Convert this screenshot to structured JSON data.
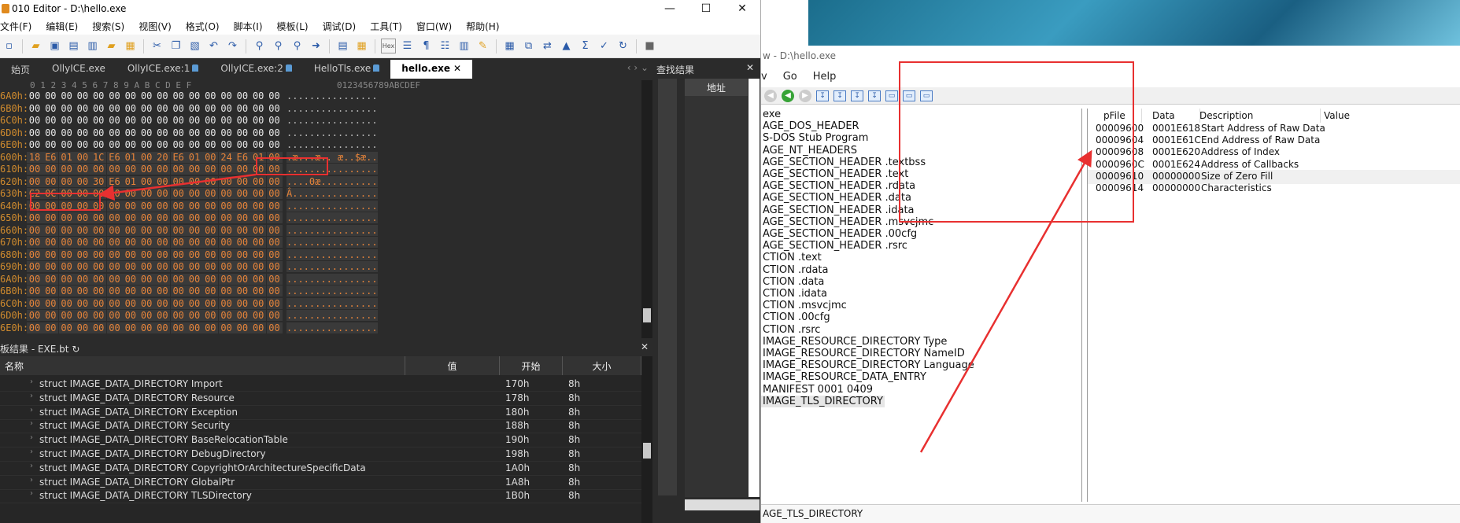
{
  "editor": {
    "title": "010 Editor - D:\\hello.exe",
    "win_min": "—",
    "win_max": "☐",
    "win_close": "✕",
    "menu": [
      "文件(F)",
      "编辑(E)",
      "搜索(S)",
      "视图(V)",
      "格式(O)",
      "脚本(I)",
      "模板(L)",
      "调试(D)",
      "工具(T)",
      "窗口(W)",
      "帮助(H)"
    ],
    "tabs": [
      {
        "label": "始页",
        "locked": false,
        "active": false
      },
      {
        "label": "OllyICE.exe",
        "locked": false,
        "active": false
      },
      {
        "label": "OllyICE.exe:1",
        "locked": true,
        "active": false
      },
      {
        "label": "OllyICE.exe:2",
        "locked": true,
        "active": false
      },
      {
        "label": "HelloTls.exe",
        "locked": true,
        "active": false
      },
      {
        "label": "hello.exe",
        "locked": false,
        "active": true
      }
    ],
    "tab_close": "✕",
    "tab_nav": "‹ › ⌄",
    "hex_header": "0  1  2  3  4  5  6  7  8  9  A  B  C  D  E  F",
    "ascii_header": "0123456789ABCDEF",
    "hex_rows": [
      {
        "off": "6A0h:",
        "bytes": [
          "00",
          "00",
          "00",
          "00",
          "00",
          "00",
          "00",
          "00",
          "00",
          "00",
          "00",
          "00",
          "00",
          "00",
          "00",
          "00"
        ],
        "ascii": "................",
        "changed": false
      },
      {
        "off": "6B0h:",
        "bytes": [
          "00",
          "00",
          "00",
          "00",
          "00",
          "00",
          "00",
          "00",
          "00",
          "00",
          "00",
          "00",
          "00",
          "00",
          "00",
          "00"
        ],
        "ascii": "................",
        "changed": false
      },
      {
        "off": "6C0h:",
        "bytes": [
          "00",
          "00",
          "00",
          "00",
          "00",
          "00",
          "00",
          "00",
          "00",
          "00",
          "00",
          "00",
          "00",
          "00",
          "00",
          "00"
        ],
        "ascii": "................",
        "changed": false
      },
      {
        "off": "6D0h:",
        "bytes": [
          "00",
          "00",
          "00",
          "00",
          "00",
          "00",
          "00",
          "00",
          "00",
          "00",
          "00",
          "00",
          "00",
          "00",
          "00",
          "00"
        ],
        "ascii": "................",
        "changed": false
      },
      {
        "off": "6E0h:",
        "bytes": [
          "00",
          "00",
          "00",
          "00",
          "00",
          "00",
          "00",
          "00",
          "00",
          "00",
          "00",
          "00",
          "00",
          "00",
          "00",
          "00"
        ],
        "ascii": "................",
        "changed": false
      },
      {
        "off": "600h:",
        "bytes": [
          "18",
          "E6",
          "01",
          "00",
          "1C",
          "E6",
          "01",
          "00",
          "20",
          "E6",
          "01",
          "00",
          "24",
          "E6",
          "01",
          "00"
        ],
        "ascii": ".æ...æ.. æ..$æ..",
        "changed": true
      },
      {
        "off": "610h:",
        "bytes": [
          "00",
          "00",
          "00",
          "00",
          "00",
          "00",
          "00",
          "00",
          "00",
          "00",
          "00",
          "00",
          "00",
          "00",
          "00",
          "00"
        ],
        "ascii": "................",
        "changed": true
      },
      {
        "off": "620h:",
        "bytes": [
          "00",
          "00",
          "00",
          "00",
          "30",
          "E6",
          "01",
          "00",
          "00",
          "00",
          "00",
          "00",
          "00",
          "00",
          "00",
          "00"
        ],
        "ascii": "....0æ..........",
        "changed": true
      },
      {
        "off": "630h:",
        "bytes": [
          "C2",
          "0C",
          "00",
          "00",
          "00",
          "00",
          "00",
          "00",
          "00",
          "00",
          "00",
          "00",
          "00",
          "00",
          "00",
          "00"
        ],
        "ascii": "Â...............",
        "changed": true
      },
      {
        "off": "640h:",
        "bytes": [
          "00",
          "00",
          "00",
          "00",
          "00",
          "00",
          "00",
          "00",
          "00",
          "00",
          "00",
          "00",
          "00",
          "00",
          "00",
          "00"
        ],
        "ascii": "................",
        "changed": true
      },
      {
        "off": "650h:",
        "bytes": [
          "00",
          "00",
          "00",
          "00",
          "00",
          "00",
          "00",
          "00",
          "00",
          "00",
          "00",
          "00",
          "00",
          "00",
          "00",
          "00"
        ],
        "ascii": "................",
        "changed": true
      },
      {
        "off": "660h:",
        "bytes": [
          "00",
          "00",
          "00",
          "00",
          "00",
          "00",
          "00",
          "00",
          "00",
          "00",
          "00",
          "00",
          "00",
          "00",
          "00",
          "00"
        ],
        "ascii": "................",
        "changed": true
      },
      {
        "off": "670h:",
        "bytes": [
          "00",
          "00",
          "00",
          "00",
          "00",
          "00",
          "00",
          "00",
          "00",
          "00",
          "00",
          "00",
          "00",
          "00",
          "00",
          "00"
        ],
        "ascii": "................",
        "changed": true
      },
      {
        "off": "680h:",
        "bytes": [
          "00",
          "00",
          "00",
          "00",
          "00",
          "00",
          "00",
          "00",
          "00",
          "00",
          "00",
          "00",
          "00",
          "00",
          "00",
          "00"
        ],
        "ascii": "................",
        "changed": true
      },
      {
        "off": "690h:",
        "bytes": [
          "00",
          "00",
          "00",
          "00",
          "00",
          "00",
          "00",
          "00",
          "00",
          "00",
          "00",
          "00",
          "00",
          "00",
          "00",
          "00"
        ],
        "ascii": "................",
        "changed": true
      },
      {
        "off": "6A0h:",
        "bytes": [
          "00",
          "00",
          "00",
          "00",
          "00",
          "00",
          "00",
          "00",
          "00",
          "00",
          "00",
          "00",
          "00",
          "00",
          "00",
          "00"
        ],
        "ascii": "................",
        "changed": true
      },
      {
        "off": "6B0h:",
        "bytes": [
          "00",
          "00",
          "00",
          "00",
          "00",
          "00",
          "00",
          "00",
          "00",
          "00",
          "00",
          "00",
          "00",
          "00",
          "00",
          "00"
        ],
        "ascii": "................",
        "changed": true
      },
      {
        "off": "6C0h:",
        "bytes": [
          "00",
          "00",
          "00",
          "00",
          "00",
          "00",
          "00",
          "00",
          "00",
          "00",
          "00",
          "00",
          "00",
          "00",
          "00",
          "00"
        ],
        "ascii": "................",
        "changed": true
      },
      {
        "off": "6D0h:",
        "bytes": [
          "00",
          "00",
          "00",
          "00",
          "00",
          "00",
          "00",
          "00",
          "00",
          "00",
          "00",
          "00",
          "00",
          "00",
          "00",
          "00"
        ],
        "ascii": "................",
        "changed": true
      },
      {
        "off": "6E0h:",
        "bytes": [
          "00",
          "00",
          "00",
          "00",
          "00",
          "00",
          "00",
          "00",
          "00",
          "00",
          "00",
          "00",
          "00",
          "00",
          "00",
          "00"
        ],
        "ascii": "................",
        "changed": true
      }
    ],
    "find_panel": {
      "title": "查找结果",
      "close": "✕",
      "col_address": "地址"
    },
    "template_panel": {
      "title": "板结果 - EXE.bt",
      "refresh_icon": "↻",
      "close": "✕",
      "columns": [
        "名称",
        "值",
        "开始",
        "大小"
      ],
      "rows": [
        {
          "name": "struct IMAGE_DATA_DIRECTORY Import",
          "start": "170h",
          "size": "8h"
        },
        {
          "name": "struct IMAGE_DATA_DIRECTORY Resource",
          "start": "178h",
          "size": "8h"
        },
        {
          "name": "struct IMAGE_DATA_DIRECTORY Exception",
          "start": "180h",
          "size": "8h"
        },
        {
          "name": "struct IMAGE_DATA_DIRECTORY Security",
          "start": "188h",
          "size": "8h"
        },
        {
          "name": "struct IMAGE_DATA_DIRECTORY BaseRelocationTable",
          "start": "190h",
          "size": "8h"
        },
        {
          "name": "struct IMAGE_DATA_DIRECTORY DebugDirectory",
          "start": "198h",
          "size": "8h"
        },
        {
          "name": "struct IMAGE_DATA_DIRECTORY CopyrightOrArchitectureSpecificData",
          "start": "1A0h",
          "size": "8h"
        },
        {
          "name": "struct IMAGE_DATA_DIRECTORY GlobalPtr",
          "start": "1A8h",
          "size": "8h"
        },
        {
          "name": "struct IMAGE_DATA_DIRECTORY TLSDirectory",
          "start": "1B0h",
          "size": "8h"
        }
      ]
    }
  },
  "peview": {
    "title": "w - D:\\hello.exe",
    "menu": [
      "v",
      "Go",
      "Help"
    ],
    "tree": [
      "exe",
      "AGE_DOS_HEADER",
      "S-DOS Stub Program",
      "AGE_NT_HEADERS",
      "AGE_SECTION_HEADER .textbss",
      "AGE_SECTION_HEADER .text",
      "AGE_SECTION_HEADER .rdata",
      "AGE_SECTION_HEADER .data",
      "AGE_SECTION_HEADER .idata",
      "AGE_SECTION_HEADER .msvcjmc",
      "AGE_SECTION_HEADER .00cfg",
      "AGE_SECTION_HEADER .rsrc",
      "CTION .text",
      "CTION .rdata",
      "CTION .data",
      "CTION .idata",
      "CTION .msvcjmc",
      "CTION .00cfg",
      "CTION .rsrc",
      "IMAGE_RESOURCE_DIRECTORY Type",
      "IMAGE_RESOURCE_DIRECTORY NameID",
      "IMAGE_RESOURCE_DIRECTORY Language",
      "IMAGE_RESOURCE_DATA_ENTRY",
      "MANIFEST  0001  0409",
      "IMAGE_TLS_DIRECTORY"
    ],
    "grid_columns": [
      "pFile",
      "Data",
      "Description",
      "Value"
    ],
    "grid_rows": [
      {
        "pfile": "00009600",
        "data": "0001E618",
        "desc": "Start Address of Raw Data"
      },
      {
        "pfile": "00009604",
        "data": "0001E61C",
        "desc": "End Address of Raw Data"
      },
      {
        "pfile": "00009608",
        "data": "0001E620",
        "desc": "Address of Index"
      },
      {
        "pfile": "0000960C",
        "data": "0001E624",
        "desc": "Address of Callbacks"
      },
      {
        "pfile": "00009610",
        "data": "00000000",
        "desc": "Size of Zero Fill"
      },
      {
        "pfile": "00009614",
        "data": "00000000",
        "desc": "Characteristics"
      }
    ],
    "status": "AGE_TLS_DIRECTORY"
  },
  "colors": {
    "annotation_red": "#e83030",
    "hex_changed": "#e6843a",
    "offset_orange": "#d08b2e"
  }
}
